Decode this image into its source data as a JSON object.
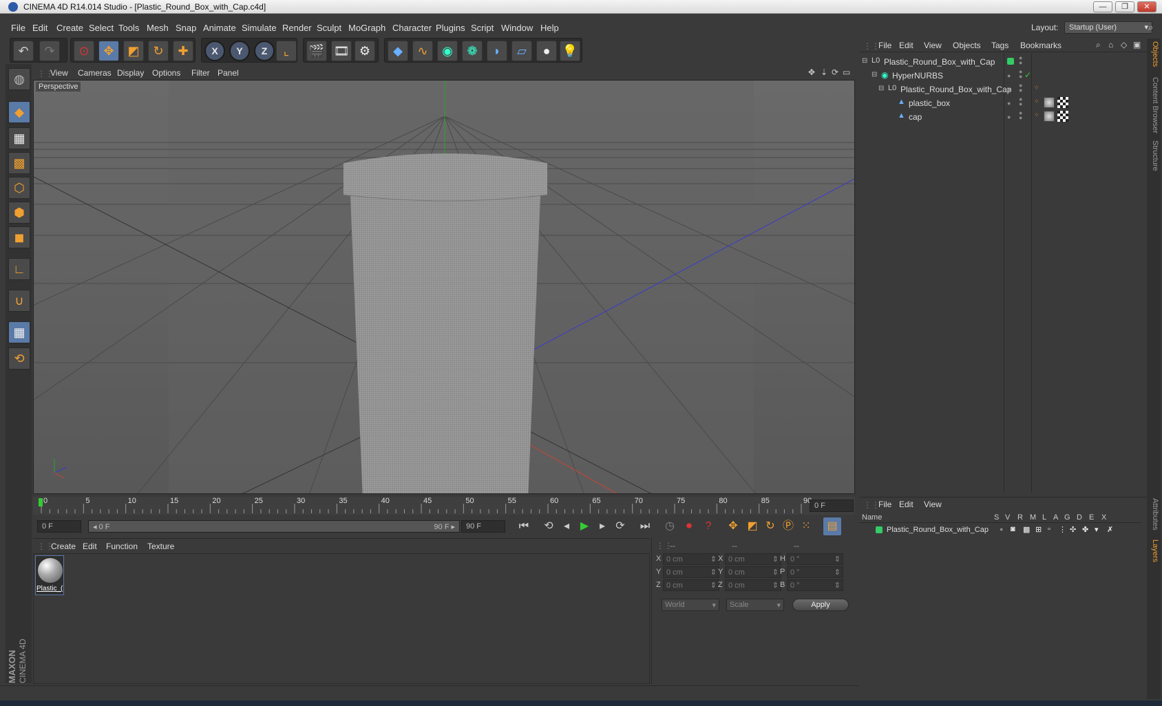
{
  "window": {
    "title": "CINEMA 4D R14.014 Studio - [Plastic_Round_Box_with_Cap.c4d]",
    "controls": [
      "—",
      "❐",
      "✕"
    ]
  },
  "menubar": {
    "items": [
      "File",
      "Edit",
      "Create",
      "Select",
      "Tools",
      "Mesh",
      "Snap",
      "Animate",
      "Simulate",
      "Render",
      "Sculpt",
      "MoGraph",
      "Character",
      "Plugins",
      "Script",
      "Window",
      "Help"
    ],
    "layout_label": "Layout:",
    "layout_value": "Startup (User)"
  },
  "viewport": {
    "menu": [
      "View",
      "Cameras",
      "Display",
      "Options",
      "Filter",
      "Panel"
    ],
    "label": "Perspective"
  },
  "timeline": {
    "ticks": [
      "0",
      "5",
      "10",
      "15",
      "20",
      "25",
      "30",
      "35",
      "40",
      "45",
      "50",
      "55",
      "60",
      "65",
      "70",
      "75",
      "80",
      "85",
      "90"
    ],
    "frame_field": "0 F"
  },
  "transport": {
    "start_field": "0 F",
    "range_start": "◂ 0 F",
    "range_end": "90 F ▸",
    "end_field": "90 F"
  },
  "material_manager": {
    "menu": [
      "Create",
      "Edit",
      "Function",
      "Texture"
    ],
    "materials": [
      {
        "name": "Plastic_("
      }
    ]
  },
  "coordinates": {
    "headers": [
      "--",
      "--",
      "--"
    ],
    "rows": [
      {
        "a": "X",
        "a_val": "0 cm",
        "b": "X",
        "b_val": "0 cm",
        "c": "H",
        "c_val": "0 °"
      },
      {
        "a": "Y",
        "a_val": "0 cm",
        "b": "Y",
        "b_val": "0 cm",
        "c": "P",
        "c_val": "0 °"
      },
      {
        "a": "Z",
        "a_val": "0 cm",
        "b": "Z",
        "b_val": "0 cm",
        "c": "B",
        "c_val": "0 °"
      }
    ],
    "mode_world": "World",
    "mode_scale": "Scale",
    "apply": "Apply"
  },
  "object_manager": {
    "menu": [
      "File",
      "Edit",
      "View",
      "Objects",
      "Tags",
      "Bookmarks"
    ],
    "objects": [
      {
        "name": "Plastic_Round_Box_with_Cap"
      },
      {
        "name": "HyperNURBS"
      },
      {
        "name": "Plastic_Round_Box_with_Cap"
      },
      {
        "name": "plastic_box"
      },
      {
        "name": "cap"
      }
    ]
  },
  "layer_manager": {
    "menu": [
      "File",
      "Edit",
      "View"
    ],
    "columns": [
      "Name",
      "S",
      "V",
      "R",
      "M",
      "L",
      "A",
      "G",
      "D",
      "E",
      "X"
    ],
    "layers": [
      {
        "name": "Plastic_Round_Box_with_Cap",
        "color": "#33cc66"
      }
    ]
  },
  "right_tabs": [
    "Objects",
    "Content Browser",
    "Structure",
    "Attributes",
    "Layers"
  ],
  "brand": {
    "line1": "MAXON",
    "line2": "CINEMA 4D"
  },
  "colors": {
    "accent_orange": "#f0a030",
    "selection_blue": "#5a7aa8",
    "layer_green": "#33cc66"
  }
}
